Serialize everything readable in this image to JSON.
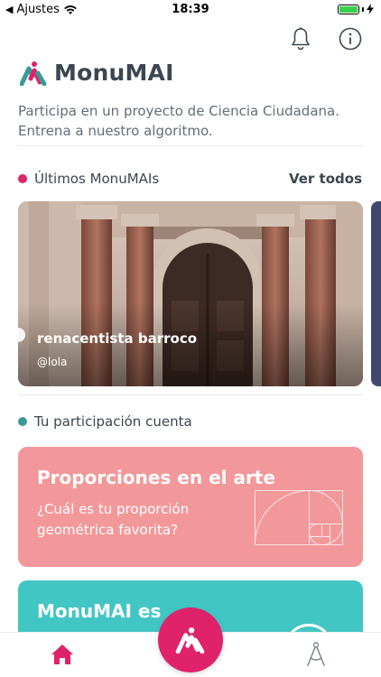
{
  "status_bar": {
    "back_app": "Ajustes",
    "time": "18:39"
  },
  "header": {
    "app_name": "MonuMAI",
    "subtitle": "Participa en un proyecto de Ciencia Ciudadana. Entrena a nuestro algoritmo."
  },
  "latest": {
    "heading": "Últimos MonuMAIs",
    "see_all": "Ver todos",
    "cards": [
      {
        "title": "renacentista barroco",
        "user": "@lola"
      }
    ]
  },
  "participation": {
    "heading": "Tu participación cuenta",
    "cards": [
      {
        "title": "Proporciones en el arte",
        "body": "¿Cuál es tu proporción geométrica favorita?"
      },
      {
        "title": "MonuMAI es"
      }
    ]
  },
  "colors": {
    "accent_pink": "#e0226b",
    "accent_teal": "#3a9a98",
    "card_pink": "#f3989a",
    "card_teal": "#42c6c4"
  },
  "icons": [
    "back-arrow-icon",
    "wifi-icon",
    "battery-icon",
    "charging-icon",
    "bell-icon",
    "info-icon",
    "logo-icon",
    "home-icon",
    "camera-logo-icon",
    "compass-icon"
  ]
}
